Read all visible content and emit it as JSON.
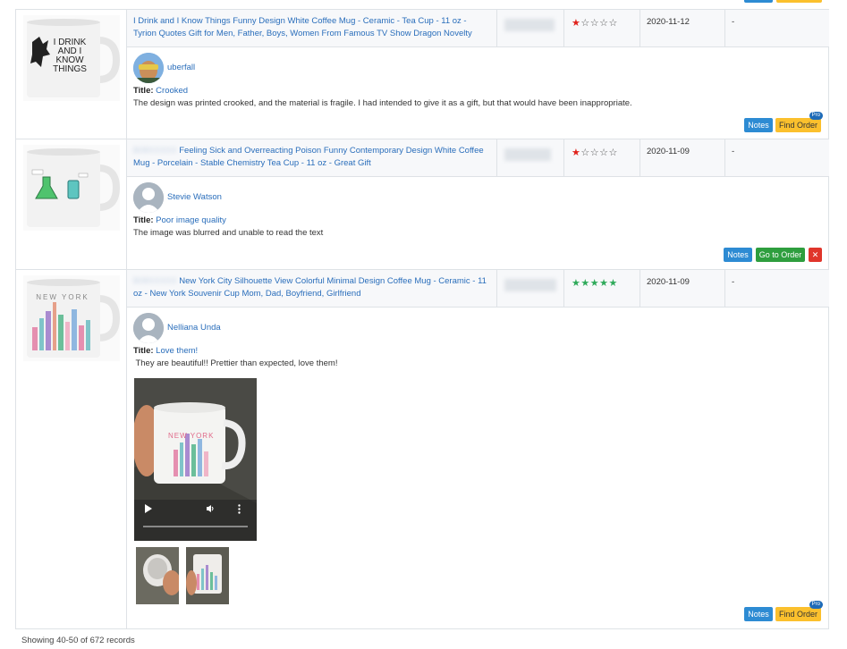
{
  "reviews": [
    {
      "product_title": "I Drink and I Know Things Funny Design White Coffee Mug - Ceramic - Tea Cup - 11 oz - Tyrion Quotes Gift for Men, Father, Boys, Women From Famous TV Show Dragon Novelty",
      "asin_prefix": "",
      "rating": 1,
      "stars_display": "★☆☆☆☆",
      "date": "2020-11-12",
      "extra": "-",
      "reviewer": "uberfall",
      "title_label": "Title:",
      "review_title": "Crooked",
      "review_text": "The design was printed crooked, and the material is fragile. I had intended to give it as a gift, but that would have been inappropriate.",
      "mug_text": "I DRINK AND I KNOW THINGS",
      "buttons": {
        "notes": "Notes",
        "find_order": "Find Order",
        "pro": "Pro"
      }
    },
    {
      "product_title": "Feeling Sick and Overreacting Poison Funny Contemporary Design White Coffee Mug - Porcelain - Stable Chemistry Tea Cup - 11 oz - Great Gift",
      "asin_prefix": "B08XXXXX",
      "rating": 1,
      "stars_display": "★☆☆☆☆",
      "date": "2020-11-09",
      "extra": "-",
      "reviewer": "Stevie Watson",
      "title_label": "Title:",
      "review_title": "Poor image quality",
      "review_text": "The image was blurred and unable to read the text",
      "buttons": {
        "notes": "Notes",
        "go_to_order": "Go to Order",
        "remove": "✕"
      }
    },
    {
      "product_title": "New York City Silhouette View Colorful Minimal Design Coffee Mug - Ceramic - 11 oz - New York Souvenir Cup Mom, Dad, Boyfriend, Girlfriend",
      "asin_prefix": "B08XXXXX",
      "rating": 5,
      "stars_display": "★★★★★",
      "date": "2020-11-09",
      "extra": "-",
      "reviewer": "Nelliana Unda",
      "title_label": "Title:",
      "review_title": "Love them!",
      "review_text": " They are beautiful!! Prettier than expected, love them!",
      "mug_text": "NEW YORK",
      "video_text": "NEW YORK",
      "buttons": {
        "notes": "Notes",
        "find_order": "Find Order",
        "pro": "Pro"
      }
    }
  ],
  "footer": {
    "records": "Showing 40-50 of 672 records"
  },
  "colors": {
    "link": "#2a6ebb",
    "star_red": "#e0221b",
    "star_green": "#2faa5a",
    "notes": "#2d8bd3",
    "find_order": "#fbc02d",
    "go_to_order": "#2e9e3e",
    "remove": "#e0352b"
  },
  "icons": {
    "play": "play-icon",
    "volume": "volume-icon",
    "more": "more-vertical-icon"
  }
}
